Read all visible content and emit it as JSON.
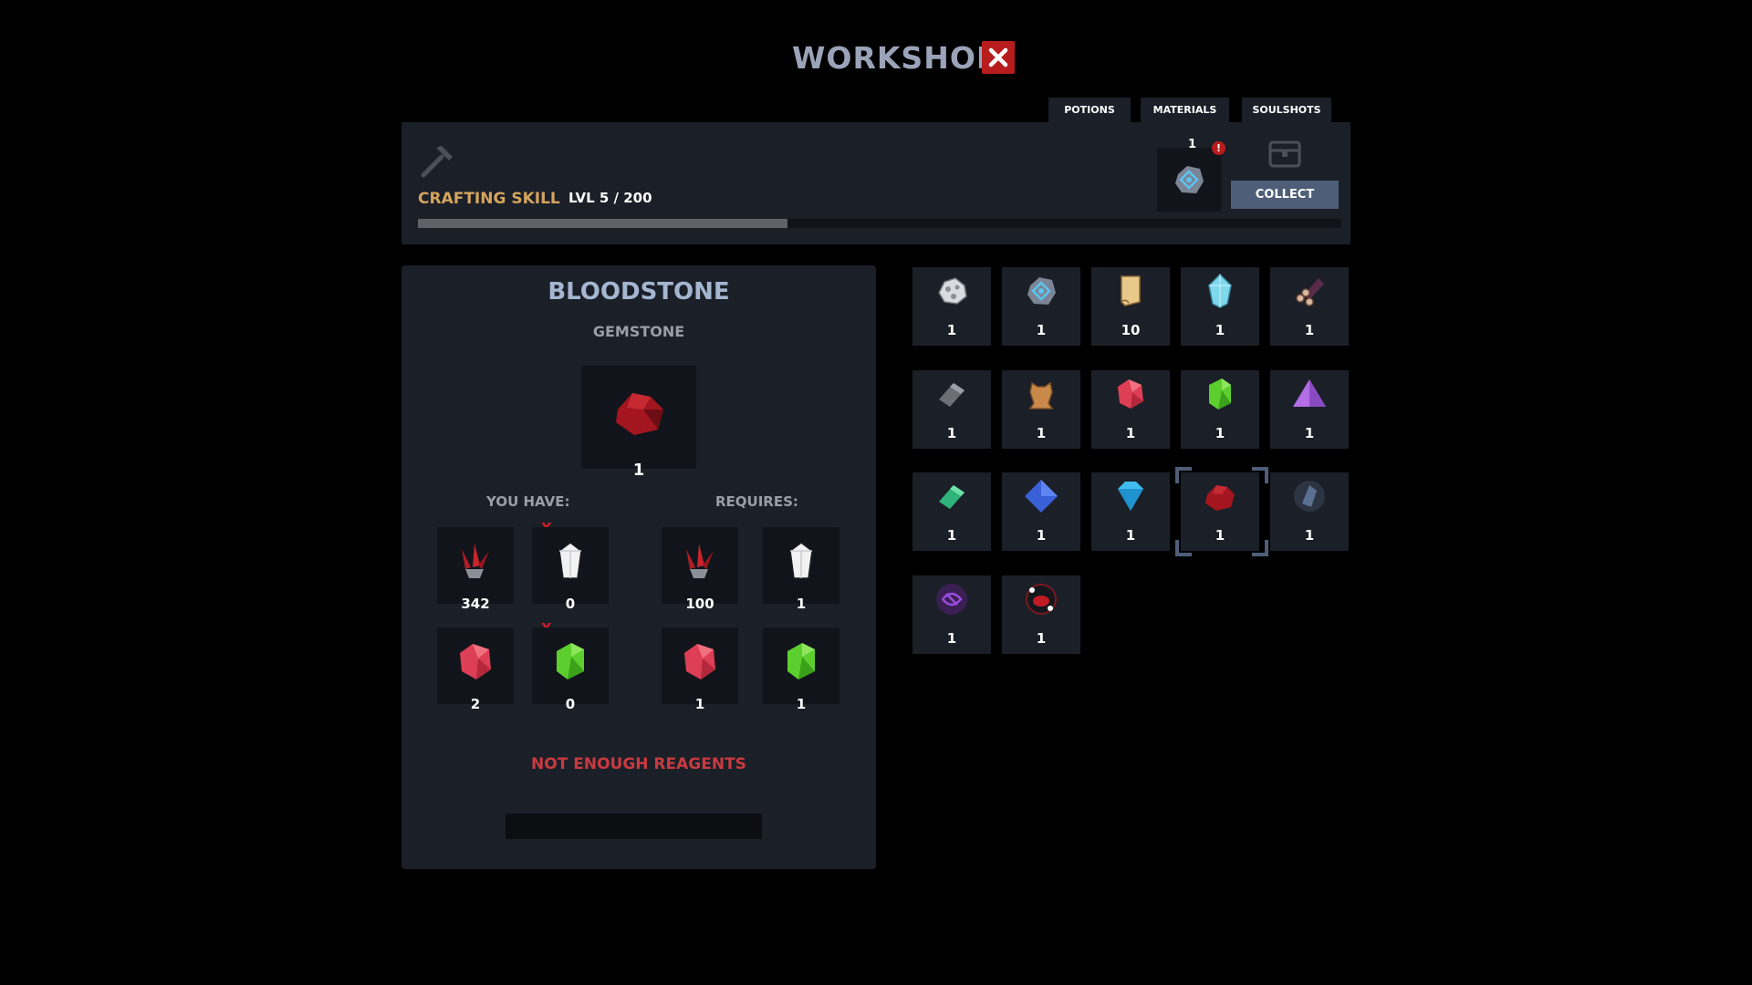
{
  "header": {
    "title": "WORKSHOP",
    "close_label": "✕"
  },
  "tabs": [
    {
      "label": "POTIONS"
    },
    {
      "label": "MATERIALS"
    },
    {
      "label": "SOULSHOTS"
    }
  ],
  "skill": {
    "label": "CRAFTING SKILL",
    "level_text": "LVL 5 / 200",
    "progress_fraction": 0.4,
    "reward_count": "1",
    "alert": "!",
    "collect_label": "COLLECT"
  },
  "detail": {
    "name": "BLOODSTONE",
    "type": "GEMSTONE",
    "quantity": "1",
    "you_have_label": "YOU HAVE:",
    "requires_label": "REQUIRES:",
    "missing_mark": "X",
    "have": [
      {
        "icon": "red-crystal-cluster-icon",
        "qty": "342"
      },
      {
        "icon": "white-crystal-icon",
        "qty": "0",
        "missing": true
      },
      {
        "icon": "red-gem-icon",
        "qty": "2"
      },
      {
        "icon": "green-gem-icon",
        "qty": "0",
        "missing": true
      }
    ],
    "requires": [
      {
        "icon": "red-crystal-cluster-icon",
        "qty": "100"
      },
      {
        "icon": "white-crystal-icon",
        "qty": "1"
      },
      {
        "icon": "red-gem-icon",
        "qty": "1"
      },
      {
        "icon": "green-gem-icon",
        "qty": "1"
      }
    ],
    "warning": "NOT ENOUGH REAGENTS"
  },
  "items": [
    {
      "icon": "silver-ore-icon",
      "qty": "1"
    },
    {
      "icon": "rune-stone-icon",
      "qty": "1"
    },
    {
      "icon": "scroll-icon",
      "qty": "10"
    },
    {
      "icon": "ice-crystal-icon",
      "qty": "1"
    },
    {
      "icon": "logs-icon",
      "qty": "1"
    },
    {
      "icon": "iron-ingot-icon",
      "qty": "1"
    },
    {
      "icon": "leather-hide-icon",
      "qty": "1"
    },
    {
      "icon": "red-gem-icon",
      "qty": "1"
    },
    {
      "icon": "green-gem-icon",
      "qty": "1"
    },
    {
      "icon": "purple-triangle-gem-icon",
      "qty": "1"
    },
    {
      "icon": "green-ingot-icon",
      "qty": "1"
    },
    {
      "icon": "blue-diamond-icon",
      "qty": "1"
    },
    {
      "icon": "cyan-diamond-icon",
      "qty": "1"
    },
    {
      "icon": "bloodstone-icon",
      "qty": "1",
      "selected": true
    },
    {
      "icon": "dark-crystal-icon",
      "qty": "1"
    },
    {
      "icon": "purple-rune-icon",
      "qty": "1"
    },
    {
      "icon": "red-eye-orb-icon",
      "qty": "1"
    }
  ],
  "colors": {
    "panel": "#1b1f27",
    "slot": "#11151b",
    "title": "#9aa3b8",
    "skill_label": "#d4a45f",
    "accent": "#4f5e78",
    "danger": "#c93a40"
  }
}
